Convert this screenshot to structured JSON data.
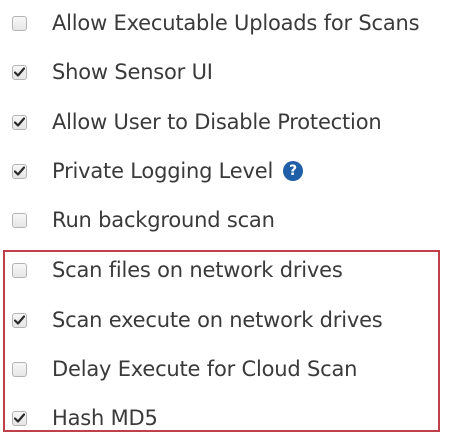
{
  "help_icon_glyph": "?",
  "accent_color": "#1f5fa8",
  "highlight_color": "#c0404a",
  "options": [
    {
      "label": "Allow Executable Uploads for Scans",
      "checked": false
    },
    {
      "label": "Show Sensor UI",
      "checked": true
    },
    {
      "label": "Allow User to Disable Protection",
      "checked": true
    },
    {
      "label": "Private Logging Level",
      "checked": true
    },
    {
      "label": "Run background scan",
      "checked": false
    },
    {
      "label": "Scan files on network drives",
      "checked": false
    },
    {
      "label": "Scan execute on network drives",
      "checked": true
    },
    {
      "label": "Delay Execute for Cloud Scan",
      "checked": false
    },
    {
      "label": "Hash MD5",
      "checked": true
    }
  ]
}
